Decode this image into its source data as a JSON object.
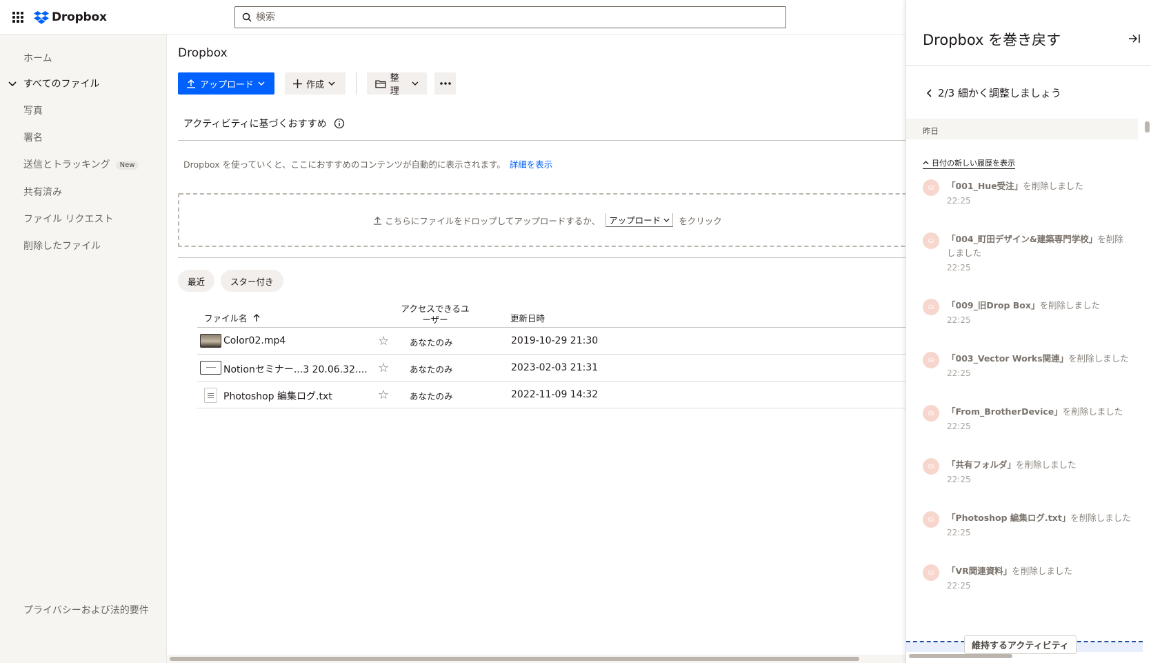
{
  "topbar": {
    "logo_text": "Dropbox",
    "search_placeholder": "検索"
  },
  "sidebar": {
    "items": [
      {
        "label": "ホーム"
      },
      {
        "label": "すべてのファイル"
      },
      {
        "label": "写真"
      },
      {
        "label": "署名"
      },
      {
        "label": "送信とトラッキング",
        "badge": "New"
      },
      {
        "label": "共有済み"
      },
      {
        "label": "ファイル リクエスト"
      },
      {
        "label": "削除したファイル"
      }
    ],
    "footer": "プライバシーおよび法的要件"
  },
  "main": {
    "breadcrumb": "Dropbox",
    "toolbar": {
      "upload": "アップロード",
      "create": "作成",
      "organize": "整理"
    },
    "suggestions": {
      "title": "アクティビティに基づくおすすめ",
      "description": "Dropbox を使っていくと、ここにおすすめのコンテンツが自動的に表示されます。",
      "link": "詳細を表示"
    },
    "dropzone": {
      "text_before": "こちらにファイルをドロップしてアップロードするか、",
      "button": "アップロード",
      "text_after": "をクリック"
    },
    "filters": {
      "recent": "最近",
      "starred": "スター付き"
    },
    "table": {
      "headers": {
        "name": "ファイル名",
        "access_line1": "アクセスできるユ",
        "access_line2": "ーザー",
        "modified": "更新日時"
      },
      "rows": [
        {
          "name": "Color02.mp4",
          "access": "あなたのみ",
          "modified": "2019-10-29 21:30",
          "icon": "video-thumbnail"
        },
        {
          "name": "Notionセミナー...3 20.06.32....",
          "access": "あなたのみ",
          "modified": "2023-02-03 21:31",
          "icon": "image-thumbnail"
        },
        {
          "name": "Photoshop 編集ログ.txt",
          "access": "あなたのみ",
          "modified": "2022-11-09 14:32",
          "icon": "text-file-icon"
        }
      ]
    }
  },
  "panel": {
    "title": "Dropbox を巻き戻す",
    "step": "2/3 細かく調整しましょう",
    "date_header": "昨日",
    "show_newer": "日付の新しい履歴を表示",
    "avatar_initials": "GI",
    "activities": [
      {
        "name": "「001_Hue受注」",
        "action": "を削除しました",
        "time": "22:25"
      },
      {
        "name": "「004_町田デザイン&建築専門学校」",
        "action": "を削除しました",
        "time": "22:25"
      },
      {
        "name": "「009_旧Drop Box」",
        "action": "を削除しました",
        "time": "22:25"
      },
      {
        "name": "「003_Vector Works関連」",
        "action": "を削除しました",
        "time": "22:25"
      },
      {
        "name": "「From_BrotherDevice」",
        "action": "を削除しました",
        "time": "22:25"
      },
      {
        "name": "「共有フォルダ」",
        "action": "を削除しました",
        "time": "22:25"
      },
      {
        "name": "「Photoshop 編集ログ.txt」",
        "action": "を削除しました",
        "time": "22:25"
      },
      {
        "name": "「VR関連資料」",
        "action": "を削除しました",
        "time": "22:25"
      }
    ],
    "keep_label": "維持するアクティビティ"
  },
  "colors": {
    "accent": "#0061fe",
    "sidebar_bg": "#f7f5f2",
    "avatar": "#f7d7cd"
  }
}
